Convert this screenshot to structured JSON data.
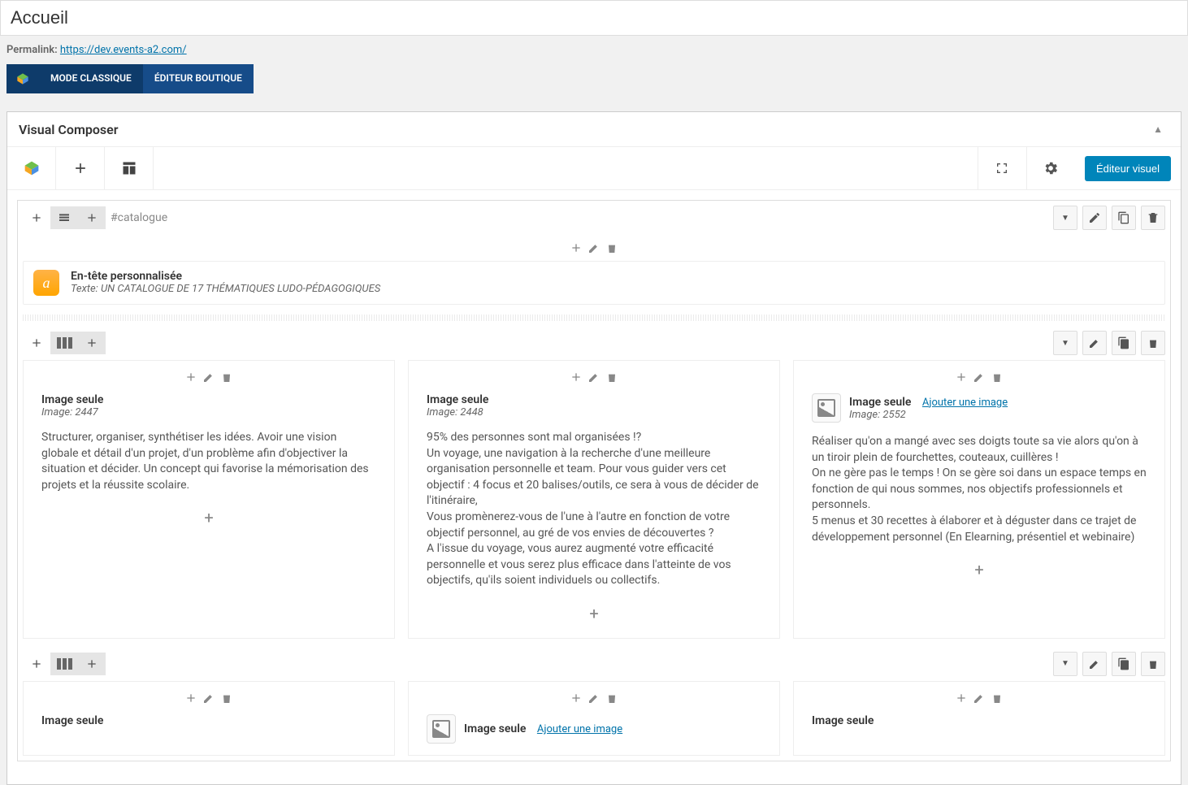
{
  "title": "Accueil",
  "permalink": {
    "label": "Permalink:",
    "url": "https://dev.events-a2.com/"
  },
  "modeTabs": {
    "classic": "MODE CLASSIQUE",
    "boutique": "ÉDITEUR BOUTIQUE"
  },
  "panel": {
    "title": "Visual Composer",
    "editorBtn": "Éditeur visuel"
  },
  "section1": {
    "tag": "#catalogue",
    "header": {
      "title": "En-tête personnalisée",
      "subtitle": "Texte: UN CATALOGUE DE 17 THÉMATIQUES LUDO-PÉDAGOGIQUES",
      "icon_glyph": "a"
    }
  },
  "row1": {
    "col1": {
      "img_title": "Image seule",
      "img_sub": "Image: 2447",
      "text": "Structurer, organiser, synthétiser les idées. Avoir une vision globale et détail d'un projet, d'un problème afin d'objectiver la situation et décider. Un concept qui favorise la mémorisation des projets et la réussite scolaire."
    },
    "col2": {
      "img_title": "Image seule",
      "img_sub": "Image: 2448",
      "text": "95% des personnes sont mal organisées !?\nUn voyage, une navigation à la recherche d'une meilleure organisation personnelle et team. Pour vous guider vers cet objectif : 4 focus et 20 balises/outils, ce sera à vous de décider de l'itinéraire,\nVous promènerez-vous de l'une à l'autre en fonction de votre objectif personnel, au gré de vos envies de découvertes ?\nA l'issue du voyage, vous aurez augmenté votre efficacité personnelle et vous serez plus efficace dans l'atteinte de vos objectifs, qu'ils soient individuels ou collectifs."
    },
    "col3": {
      "img_title": "Image seule",
      "img_sub": "Image: 2552",
      "add_link": "Ajouter une image",
      "text": "Réaliser qu'on a mangé avec ses doigts toute sa vie alors qu'on à un tiroir plein de fourchettes, couteaux, cuillères !\nOn ne gère pas le temps ! On se gère soi dans un espace temps en fonction de qui nous sommes, nos objectifs professionnels et personnels.\n5 menus et 30 recettes à élaborer et à déguster dans ce trajet de développement personnel (En Elearning, présentiel et webinaire)"
    }
  },
  "row2": {
    "col1": {
      "img_title": "Image seule"
    },
    "col2": {
      "img_title": "Image seule",
      "add_link": "Ajouter une image"
    },
    "col3": {
      "img_title": "Image seule"
    }
  }
}
